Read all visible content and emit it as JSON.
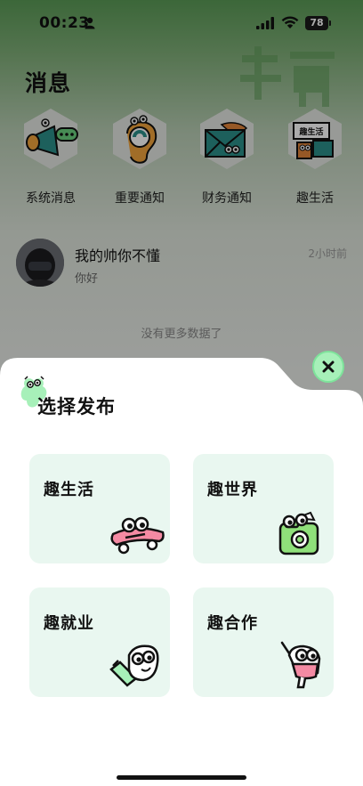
{
  "status_bar": {
    "time": "00:23",
    "battery": "78"
  },
  "page": {
    "title": "消息"
  },
  "categories": [
    {
      "label": "系统消息",
      "icon": "megaphone-icon"
    },
    {
      "label": "重要通知",
      "icon": "ear-icon"
    },
    {
      "label": "财务通知",
      "icon": "envelope-icon"
    },
    {
      "label": "趣生活",
      "icon": "sign-icon",
      "sign_text": "趣生活"
    }
  ],
  "messages": [
    {
      "name": "我的帅你不懂",
      "preview": "你好",
      "time": "2小时前"
    }
  ],
  "list_footer": "没有更多数据了",
  "sheet": {
    "title": "选择发布",
    "options": [
      {
        "label": "趣生活",
        "icon": "skateboard-icon"
      },
      {
        "label": "趣世界",
        "icon": "camera-icon"
      },
      {
        "label": "趣就业",
        "icon": "cup-icon"
      },
      {
        "label": "趣合作",
        "icon": "juice-box-icon"
      }
    ]
  },
  "colors": {
    "accent_green": "#a7f0b9",
    "card_bg": "#e9f7f0",
    "pink": "#f48aa3"
  }
}
